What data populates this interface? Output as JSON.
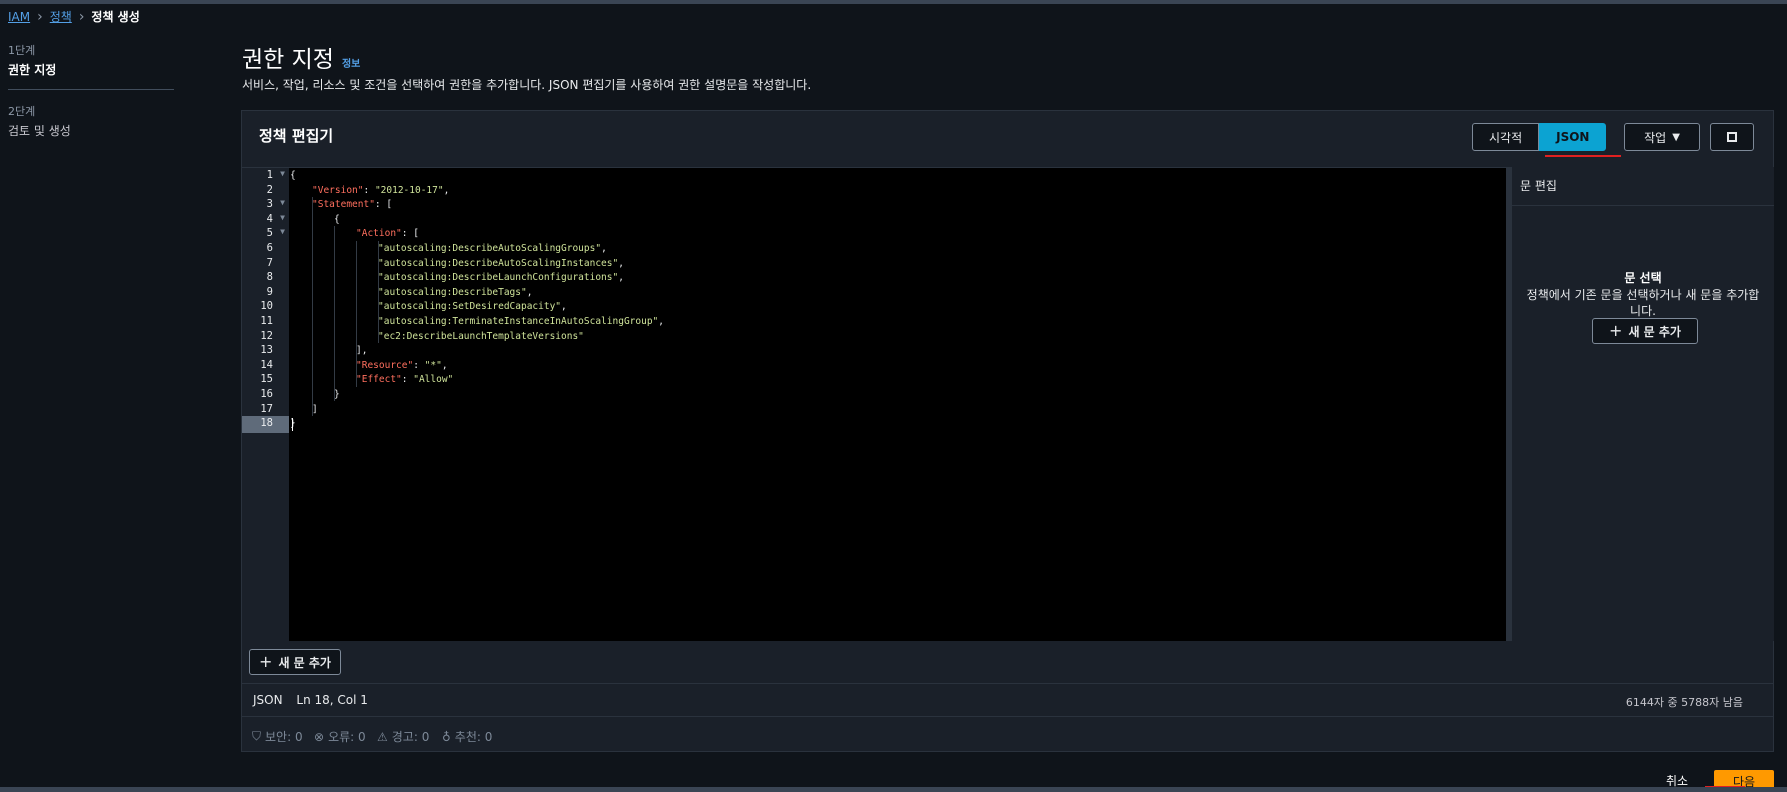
{
  "breadcrumb": {
    "root": "IAM",
    "parent": "정책",
    "current": "정책 생성"
  },
  "steps": [
    {
      "num": "1단계",
      "title": "권한 지정"
    },
    {
      "num": "2단계",
      "title": "검토 및 생성"
    }
  ],
  "page": {
    "title": "권한 지정",
    "info_link": "정보",
    "description": "서비스, 작업, 리소스 및 조건을 선택하여 권한을 추가합니다. JSON 편집기를 사용하여 권한 설명문을 작성합니다."
  },
  "editor": {
    "title": "정책 편집기",
    "mode_visual": "시각적",
    "mode_json": "JSON",
    "selected_mode": "JSON",
    "actions_label": "작업",
    "add_statement": "새 문 추가",
    "line_numbers": [
      "1",
      "2",
      "3",
      "4",
      "5",
      "6",
      "7",
      "8",
      "9",
      "10",
      "11",
      "12",
      "13",
      "14",
      "15",
      "16",
      "17",
      "18"
    ],
    "code": {
      "l1": "{",
      "version_key": "\"Version\"",
      "version_val": "\"2012-10-17\"",
      "statement_key": "\"Statement\"",
      "l4": "{",
      "action_key": "\"Action\"",
      "actions": [
        "\"autoscaling:DescribeAutoScalingGroups\"",
        "\"autoscaling:DescribeAutoScalingInstances\"",
        "\"autoscaling:DescribeLaunchConfigurations\"",
        "\"autoscaling:DescribeTags\"",
        "\"autoscaling:SetDesiredCapacity\"",
        "\"autoscaling:TerminateInstanceInAutoScalingGroup\"",
        "\"ec2:DescribeLaunchTemplateVersions\""
      ],
      "l13": "],",
      "resource_key": "\"Resource\"",
      "resource_val": "\"*\"",
      "effect_key": "\"Effect\"",
      "effect_val": "\"Allow\"",
      "l16": "}",
      "l17": "]",
      "l18": "}"
    },
    "status_mode": "JSON",
    "cursor_position": "Ln 18, Col 1",
    "char_count": "6144자 중 5788자 남음"
  },
  "side_panel": {
    "title": "문 편집",
    "heading": "문 선택",
    "description": "정책에서 기존 문을 선택하거나 새 문을 추가합니다.",
    "add_button": "새 문 추가"
  },
  "validation": [
    {
      "icon": "shield-icon",
      "label": "보안: 0"
    },
    {
      "icon": "error-icon",
      "label": "오류: 0"
    },
    {
      "icon": "warning-icon",
      "label": "경고: 0"
    },
    {
      "icon": "suggestion-icon",
      "label": "추천: 0"
    }
  ],
  "footer": {
    "cancel": "취소",
    "next": "다음"
  },
  "colors": {
    "accent": "#0ca3d2",
    "primary": "#ff9900",
    "highlight": "#e02020"
  }
}
